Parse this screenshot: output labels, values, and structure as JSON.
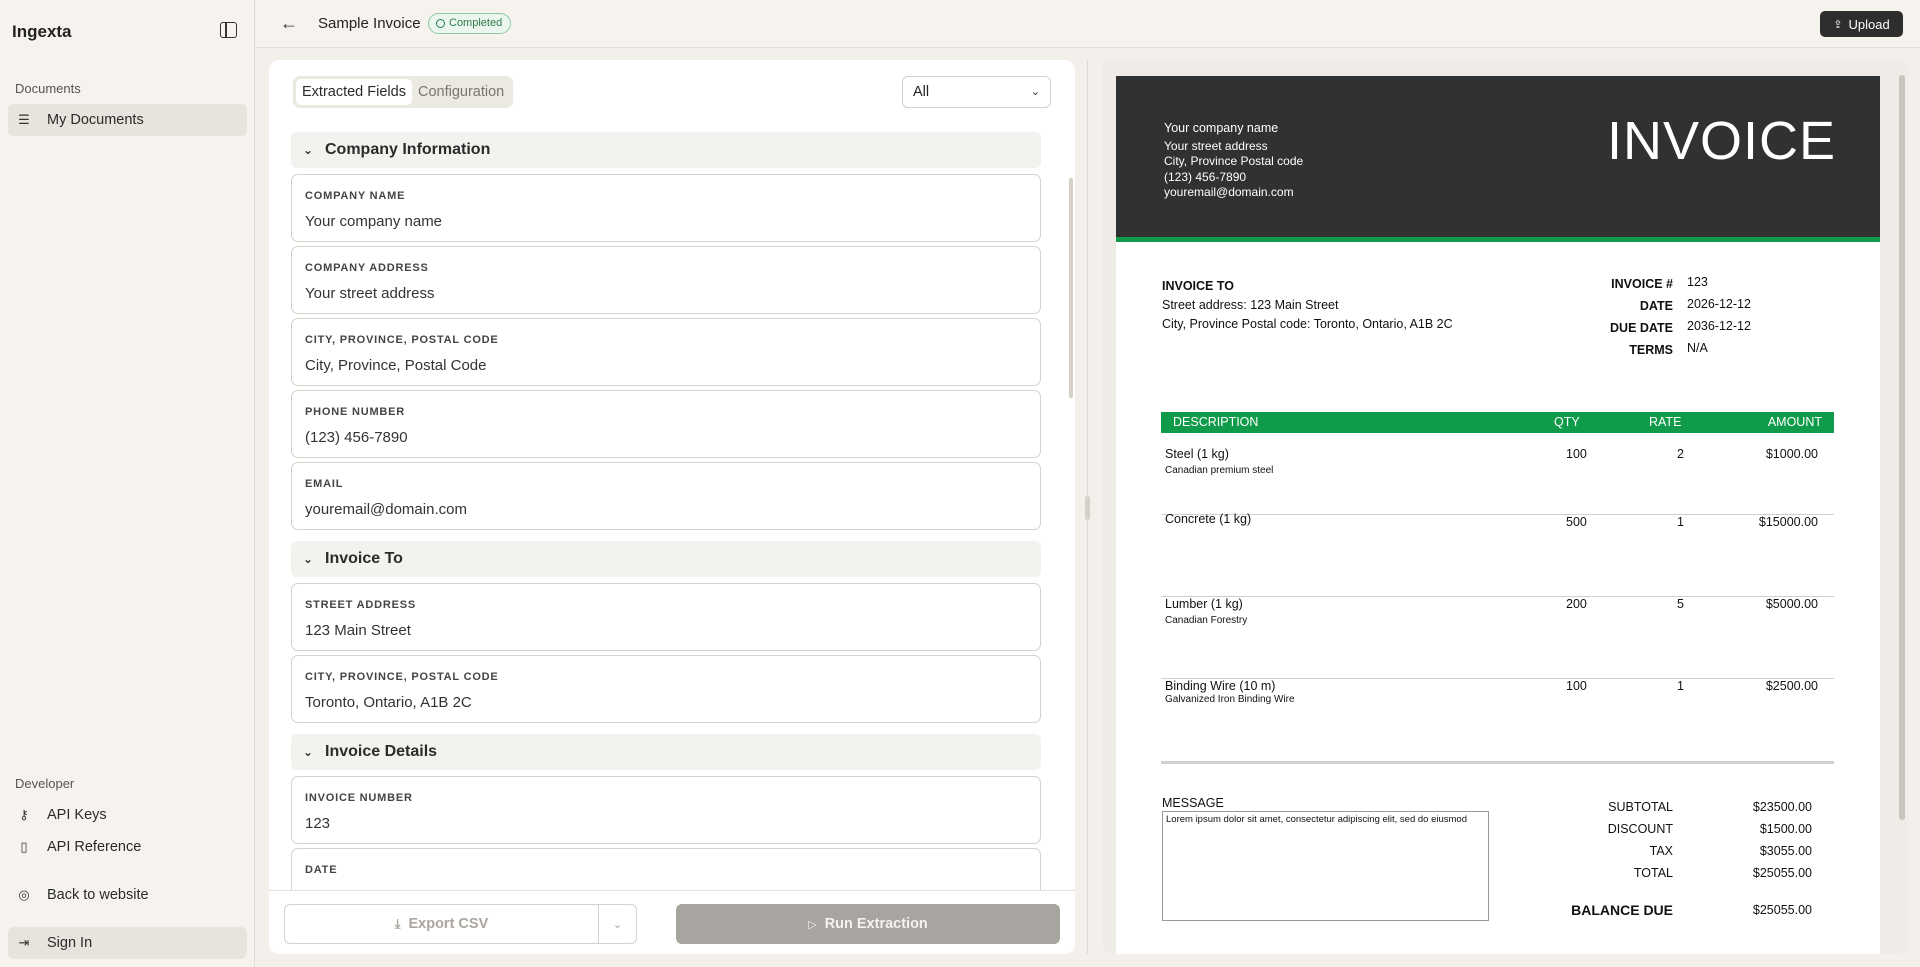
{
  "sidebar": {
    "brand": "Ingexta",
    "section_documents": "Documents",
    "my_documents": "My Documents",
    "section_developer": "Developer",
    "api_keys": "API Keys",
    "api_reference": "API Reference",
    "back_to_website": "Back to website",
    "sign_in": "Sign In"
  },
  "header": {
    "title": "Sample Invoice",
    "status": "Completed",
    "upload_label": "Upload"
  },
  "tabs": {
    "extracted": "Extracted Fields",
    "configuration": "Configuration"
  },
  "filter": {
    "selected": "All"
  },
  "sections": {
    "company": "Company Information",
    "invoice_to": "Invoice To",
    "invoice_details": "Invoice Details"
  },
  "fields": {
    "company_name": {
      "label": "COMPANY NAME",
      "value": "Your company name"
    },
    "company_address": {
      "label": "COMPANY ADDRESS",
      "value": "Your street address"
    },
    "company_city": {
      "label": "CITY, PROVINCE, POSTAL CODE",
      "value": "City, Province, Postal Code"
    },
    "phone": {
      "label": "PHONE NUMBER",
      "value": "(123) 456-7890"
    },
    "email": {
      "label": "EMAIL",
      "value": "youremail@domain.com"
    },
    "street_address": {
      "label": "STREET ADDRESS",
      "value": "123 Main Street"
    },
    "to_city": {
      "label": "CITY, PROVINCE, POSTAL CODE",
      "value": "Toronto, Ontario, A1B 2C"
    },
    "invoice_number": {
      "label": "INVOICE NUMBER",
      "value": "123"
    },
    "date": {
      "label": "DATE",
      "value": ""
    }
  },
  "footer": {
    "export_label": "Export CSV",
    "run_label": "Run Extraction"
  },
  "invoice": {
    "company_name": "Your company name",
    "street": "Your street address",
    "city": "City, Province  Postal code",
    "phone": "(123) 456-7890",
    "email": "youremail@domain.com",
    "heading": "INVOICE",
    "to_heading": "INVOICE TO",
    "to_street": "Street address: 123 Main Street",
    "to_city": "City, Province  Postal code: Toronto, Ontario, A1B 2C",
    "meta": [
      {
        "k": "INVOICE #",
        "v": "123"
      },
      {
        "k": "DATE",
        "v": "2026-12-12"
      },
      {
        "k": "DUE DATE",
        "v": "2036-12-12"
      },
      {
        "k": "TERMS",
        "v": "N/A"
      }
    ],
    "cols": {
      "desc": "DESCRIPTION",
      "qty": "QTY",
      "rate": "RATE",
      "amount": "AMOUNT"
    },
    "items": [
      {
        "desc": "Steel (1 kg)",
        "sub": "Canadian premium steel",
        "qty": "100",
        "rate": "2",
        "amount": "$1000.00"
      },
      {
        "desc": "Concrete (1 kg)",
        "sub": "",
        "qty": "500",
        "rate": "1",
        "amount": "$15000.00"
      },
      {
        "desc": "Lumber (1 kg)",
        "sub": "Canadian Forestry",
        "qty": "200",
        "rate": "5",
        "amount": "$5000.00"
      },
      {
        "desc": "Binding Wire (10 m)",
        "sub": "Galvanized Iron Binding Wire",
        "qty": "100",
        "rate": "1",
        "amount": "$2500.00"
      }
    ],
    "message_label": "MESSAGE",
    "message": "Lorem ipsum dolor sit amet, consectetur adipiscing elit, sed do eiusmod",
    "totals": [
      {
        "k": "SUBTOTAL",
        "v": "$23500.00"
      },
      {
        "k": "DISCOUNT",
        "v": "$1500.00"
      },
      {
        "k": "TAX",
        "v": "$3055.00"
      },
      {
        "k": "TOTAL",
        "v": "$25055.00"
      }
    ],
    "balance_label": "BALANCE DUE",
    "balance": "$25055.00"
  }
}
